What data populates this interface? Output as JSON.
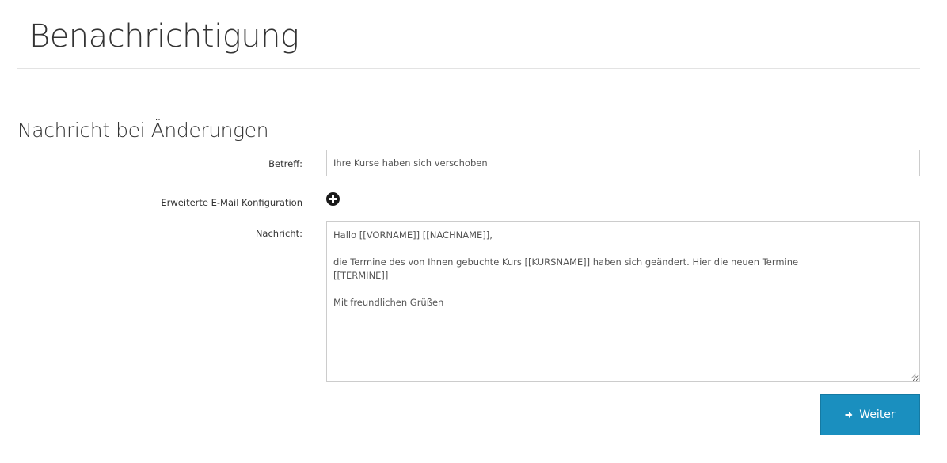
{
  "page": {
    "title": "Benachrichtigung"
  },
  "section": {
    "title": "Nachricht bei Änderungen"
  },
  "form": {
    "subject_label": "Betreff:",
    "subject_value": "Ihre Kurse haben sich verschoben",
    "advanced_label": "Erweiterte E-Mail Konfiguration",
    "advanced_icon": "plus-circle-icon",
    "message_label": "Nachricht:",
    "message_lines": [
      "Hallo [[VORNAME]] [[NACHNAME]],",
      "",
      "die Termine des von Ihnen gebuchte Kurs [[KURSNAME]] haben sich geändert. Hier die neuen Termine",
      "[[TERMINE]]",
      "",
      "Mit freundlichen Grüßen"
    ]
  },
  "actions": {
    "submit_label": "Weiter",
    "submit_icon": "arrow-right-icon",
    "submit_color": "#1a8fbf"
  }
}
